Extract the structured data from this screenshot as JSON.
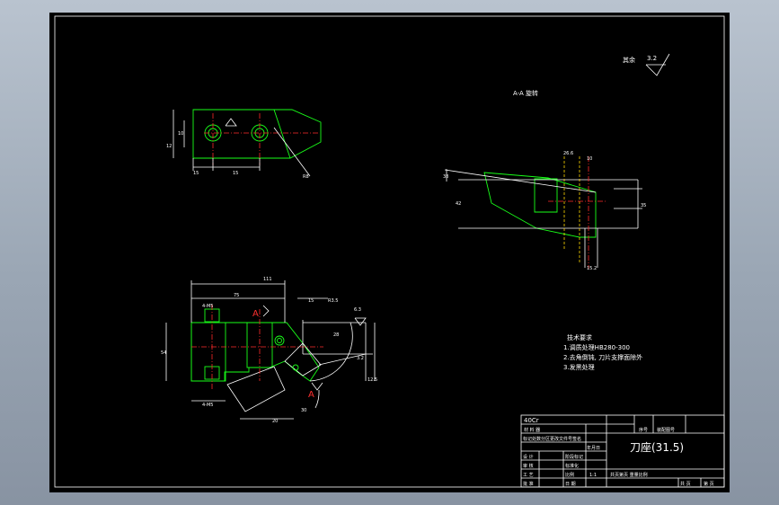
{
  "drawing": {
    "title_symbol_label": "其余",
    "title_symbol_value": "3.2",
    "section_label": "A-A 旋转",
    "section_marker": "A"
  },
  "tech_requirements": {
    "heading": "技术要求",
    "lines": [
      "1.调质处理HB280-300",
      "2.去角倒钝, 刀片支撑面除外",
      "3.发黑处理"
    ]
  },
  "title_block": {
    "material": "40Cr",
    "part_name": "刀座(31.5)",
    "scale": "1:1",
    "cells": {
      "material_label": "材 料 器",
      "seq_label": "序号",
      "asm_label": "装配图号",
      "small_header": "标记处数分区更改文件号签名",
      "date_label": "年月日",
      "design": "设 计",
      "check": "审 核",
      "process": "工 艺",
      "std": "标准化",
      "approve": "批 准",
      "stage_label": "阶段标记",
      "weight_label": "重量",
      "scale_label": "比例",
      "sheet_total": "共 页",
      "sheet_no": "第 页",
      "date": "日 期",
      "bottom_note": "共页第页 重量比例"
    }
  },
  "dimensions": {
    "top_view": [
      "15",
      "15",
      "12",
      "10",
      "R8"
    ],
    "front_view": [
      "111",
      "75",
      "15",
      "R3.5",
      "28",
      "54",
      "6.3",
      "4-M5",
      "20",
      "30",
      "12.5",
      "3.2"
    ],
    "section_view": [
      "26.6",
      "10",
      "38",
      "35",
      "42",
      "15.2"
    ]
  }
}
